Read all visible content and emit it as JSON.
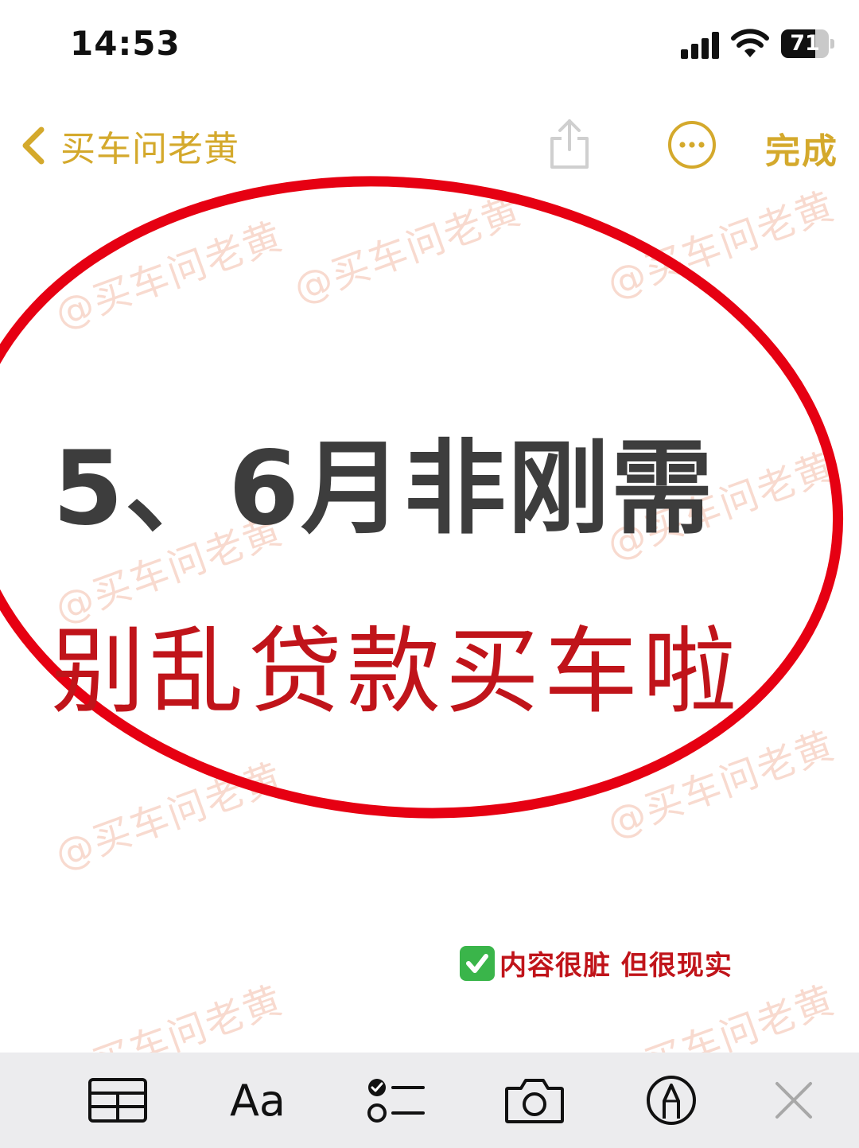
{
  "status_bar": {
    "time": "14:53",
    "battery_level": "71",
    "battery_fraction": 0.71
  },
  "nav": {
    "back_label": "买车问老黄",
    "done_label": "完成",
    "accent_color": "#d4a92c"
  },
  "watermark_text": "@买车问老黄",
  "content": {
    "headline": "5、6月非刚需",
    "subline": "别乱贷款买车啦",
    "note": "内容很脏 但很现实",
    "headline_color": "#3d3d3d",
    "subline_color": "#c0141a",
    "ellipse_color": "#e60012"
  },
  "toolbar": {
    "icons": [
      "table-icon",
      "text-format-icon",
      "checklist-icon",
      "camera-icon",
      "markup-pen-icon",
      "close-icon"
    ],
    "text_format_label": "Aa"
  }
}
